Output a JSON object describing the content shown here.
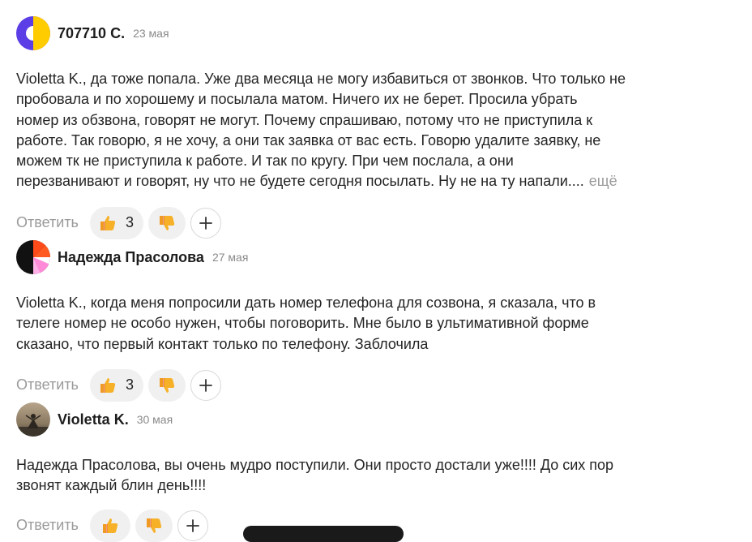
{
  "comments": [
    {
      "author": "707710 С.",
      "date": "23 мая",
      "lines": [
        "Violetta K., да тоже попала. Уже два месяца не могу избавиться от звонков. Что только не",
        "пробовала и по хорошему и посылала матом. Ничего их не берет. Просила убрать",
        "номер из обзвона, говорят не могут. Почему спрашиваю, потому что не приступила к",
        "работе. Так говорю, я не хочу, а они так заявка от вас есть. Говорю удалите заявку, не",
        "можем тк не приступила к работе. И так по кругу. При чем послала, а они",
        "перезванивают и говорят, ну что не будете сегодня посылать. Ну не на ту напали...."
      ],
      "more_label": "ещё",
      "reply_label": "Ответить",
      "likes": "3"
    },
    {
      "author": "Надежда Прасолова",
      "date": "27 мая",
      "lines": [
        "Violetta K., когда меня попросили дать номер телефона для созвона, я сказала, что в",
        "телеге номер не особо нужен, чтобы поговорить. Мне было в ультимативной форме",
        "сказано, что первый контакт только по телефону. Заблочила"
      ],
      "reply_label": "Ответить",
      "likes": "3"
    },
    {
      "author": "Violetta K.",
      "date": "30 мая",
      "lines": [
        "Надежда Прасолова, вы очень мудро поступили. Они просто достали уже!!!! До сих пор",
        "звонят каждый блин день!!!!"
      ],
      "reply_label": "Ответить"
    }
  ],
  "icons": {
    "like": "thumbs-up-icon",
    "dislike": "thumbs-down-icon",
    "add": "plus-icon"
  },
  "colors": {
    "pill_bg": "#f0f0f0",
    "muted_text": "#9a9a9a",
    "thumb_yellow": "#f6b128",
    "thumb_red": "#e8452c"
  }
}
